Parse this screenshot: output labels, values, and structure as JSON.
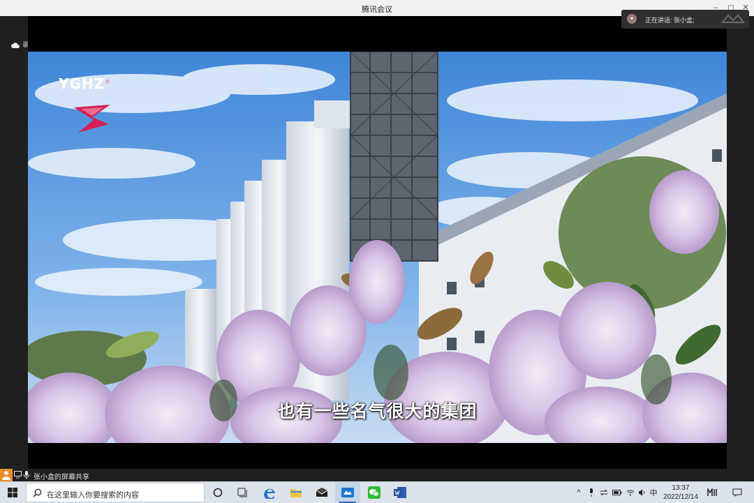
{
  "window": {
    "title": "腾讯会议",
    "minimize": "–",
    "restore": "◻",
    "close": "✕"
  },
  "speaker": {
    "label": "正在讲话: 张小盒;"
  },
  "recording": {
    "label": "录制中"
  },
  "video": {
    "brand": "YGHZ",
    "brand_mark": "®",
    "subtitle": "也有一些名气很大的集团"
  },
  "share_bar": {
    "label": "张小盒的屏幕共享"
  },
  "taskbar": {
    "search_placeholder": "在这里输入你要搜索的内容",
    "ime": "中",
    "time": "13:37",
    "date": "2022/12/14",
    "overflow": "^",
    "apps": [
      "cortana",
      "task-view",
      "edge",
      "file-explorer",
      "mail",
      "tencent-meeting",
      "wechat",
      "word"
    ]
  }
}
